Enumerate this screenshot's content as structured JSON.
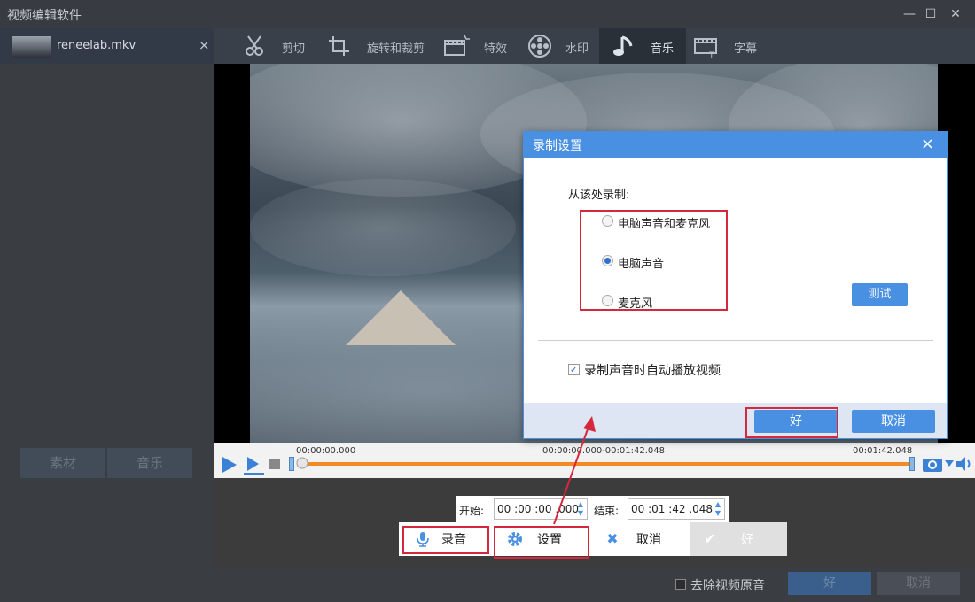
{
  "window": {
    "title": "视频编辑软件",
    "min_icon": "minimize-icon",
    "max_icon": "maximize-icon",
    "close_icon": "close-icon"
  },
  "file": {
    "name": "reneelab.mkv",
    "close": "×"
  },
  "left_buttons": {
    "material": "素材",
    "music": "音乐"
  },
  "toolbar": {
    "items": [
      {
        "label": "剪切",
        "icon": "cut-icon"
      },
      {
        "label": "旋转和裁剪",
        "icon": "rotate-crop-icon"
      },
      {
        "label": "特效",
        "icon": "effects-icon"
      },
      {
        "label": "水印",
        "icon": "watermark-icon"
      },
      {
        "label": "音乐",
        "icon": "music-note-icon"
      },
      {
        "label": "字幕",
        "icon": "subtitle-icon"
      }
    ]
  },
  "timeline": {
    "start": "00:00:00.000",
    "range": "00:00:00.000-00:01:42.048",
    "end": "00:01:42.048"
  },
  "time_range": {
    "start_label": "开始:",
    "start_value": "00 :00 :00 .000",
    "end_label": "结束:",
    "end_value": "00 :01 :42 .048"
  },
  "actions": {
    "record": "录音",
    "settings": "设置",
    "cancel": "取消",
    "ok": "好"
  },
  "bottom": {
    "remove_audio": "去除视频原音",
    "ok": "好",
    "cancel": "取消"
  },
  "dialog": {
    "title": "录制设置",
    "close": "×",
    "from_label": "从该处录制:",
    "options": [
      {
        "label": "电脑声音和麦克风",
        "checked": false
      },
      {
        "label": "电脑声音",
        "checked": true
      },
      {
        "label": "麦克风",
        "checked": false
      }
    ],
    "test": "测试",
    "autoplay": "录制声音时自动播放视频",
    "autoplay_checked": true,
    "ok": "好",
    "cancel": "取消"
  },
  "colors": {
    "accent": "#4a90e2",
    "highlight": "#d6283c",
    "progress": "#f08a24"
  }
}
